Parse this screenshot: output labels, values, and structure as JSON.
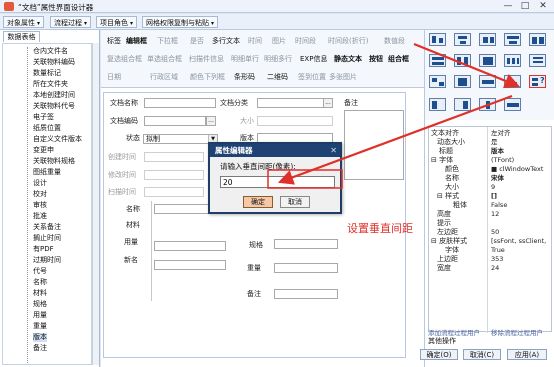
{
  "window": {
    "title": "“文档”属性界面设计器",
    "minimize": "—",
    "maximize": "□",
    "close": "✕"
  },
  "topbar": {
    "items": [
      "对象属性",
      "流程过程",
      "项目角色",
      "网格权限复制与粘贴"
    ]
  },
  "left_panel": {
    "tab": "数据表格",
    "tree_items": [
      "仓内文件名",
      "关联物料编码",
      "数量标记",
      "所在文件夹",
      "本地创建时间",
      "关联物料代号",
      "电子签",
      "纸质位置",
      "自定义文件版本",
      "变更申",
      "关联物料规格",
      "图纸重量",
      "设计",
      "校对",
      "审核",
      "批准",
      "关系备注",
      "搁止时间",
      "有PDF",
      "过期时间",
      "代号",
      "名称",
      "材料",
      "规格",
      "用量",
      "重量",
      "版本",
      "备注"
    ],
    "selected_item": "版本"
  },
  "ribbon": {
    "row1": [
      "标签",
      "编辑框",
      "下拉框",
      "是否",
      "多行文本",
      "时间",
      "图片",
      "时间段",
      "时间段(折行)",
      "数值段"
    ],
    "row2": [
      "复选组合框",
      "单选组合框",
      "扫描件信息",
      "明细单行",
      "明细多行",
      "EXP信息",
      "静态文本",
      "按钮",
      "组合框"
    ],
    "row3": [
      "日期",
      "行政区域",
      "颜色下列框",
      "条形码",
      "二维码",
      "签到位置",
      "多张图片"
    ]
  },
  "form": {
    "labels": {
      "doc_name": "文档名称",
      "doc_category": "文档分类",
      "doc_code": "文档编码",
      "size": "大小",
      "status": "状态",
      "version": "版本",
      "created_time": "创建时间",
      "modified_time": "修改时间",
      "scanned_time": "扫描时间",
      "remark_side": "备注",
      "name": "名称",
      "material": "材料",
      "quantity": "用量",
      "spec": "规格",
      "newname": "新名",
      "weight": "重量",
      "remark_bottom": "备注"
    },
    "status_value": "拟制",
    "category_dots": "...",
    "code_dots": "..."
  },
  "dialog": {
    "title": "属性编辑器",
    "close": "✕",
    "prompt": "请输入垂直间距(像素):",
    "input_value": "20",
    "ok": "确定",
    "cancel": "取消"
  },
  "annotation": {
    "text": "设置垂直间距",
    "color": "#e0302a"
  },
  "properties": {
    "rows": [
      {
        "key": "文本对齐",
        "value": "左对齐"
      },
      {
        "key": "动态大小",
        "value": "是"
      },
      {
        "key": "标题",
        "value": "版本",
        "bold": true
      },
      {
        "key": "⊟ 字体",
        "value": "(TFont)"
      },
      {
        "key": "颜色",
        "value": "■ clWindowText"
      },
      {
        "key": "名称",
        "value": "宋体",
        "bold": true
      },
      {
        "key": "大小",
        "value": "9"
      },
      {
        "key": "⊟ 样式",
        "value": "[]"
      },
      {
        "key": "粗体",
        "value": "False"
      },
      {
        "key": "高度",
        "value": "12"
      },
      {
        "key": "提示",
        "value": ""
      },
      {
        "key": "左边距",
        "value": "50"
      },
      {
        "key": "⊟ 皮肤样式",
        "value": "[ssFont, ssClient,"
      },
      {
        "key": "字体",
        "value": "True"
      },
      {
        "key": "上边距",
        "value": "353"
      },
      {
        "key": "宽度",
        "value": "24"
      }
    ],
    "link_left": "添加流程过程用户",
    "link_right": "移除流程过程用户",
    "help": "其他操作",
    "buttons": [
      "确定(O)",
      "取消(C)",
      "应用(A)"
    ]
  }
}
